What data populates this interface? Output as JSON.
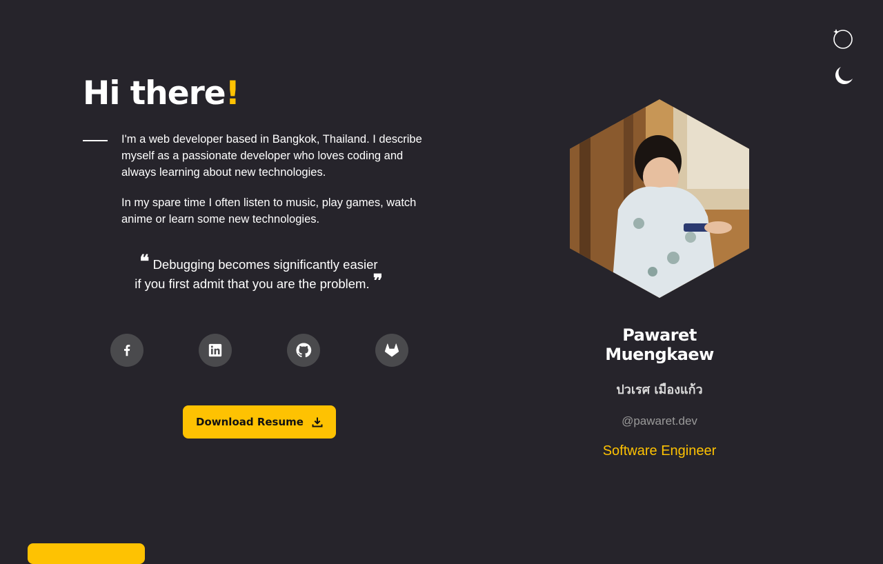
{
  "header": {
    "theme_icons": [
      "sparkle-circle-icon",
      "moon-icon"
    ]
  },
  "hero": {
    "greeting": "Hi there",
    "greeting_accent": "!",
    "bio": [
      "I'm a web developer based in Bangkok, Thailand. I describe myself as a passionate developer who loves coding and always learning about new technologies.",
      "In my spare time I often listen to music, play games, watch anime or learn some new technologies."
    ],
    "quote_line1": "Debugging becomes significantly easier",
    "quote_line2": "if you first admit that you are the problem.",
    "quote_open": "❝",
    "quote_close": "❞",
    "socials": [
      "facebook-icon",
      "linkedin-icon",
      "github-icon",
      "gitlab-icon"
    ],
    "resume_label": "Download Resume",
    "resume_icon": "download-icon"
  },
  "profile": {
    "name": "Pawaret Muengkaew",
    "thai_name": "ปวเรศ เมืองแก้ว",
    "handle": "@pawaret.dev",
    "role": "Software Engineer",
    "photo": "profile-photo"
  },
  "colors": {
    "background": "#26242b",
    "accent": "#fec202",
    "social_bg": "#4a4a4d"
  }
}
